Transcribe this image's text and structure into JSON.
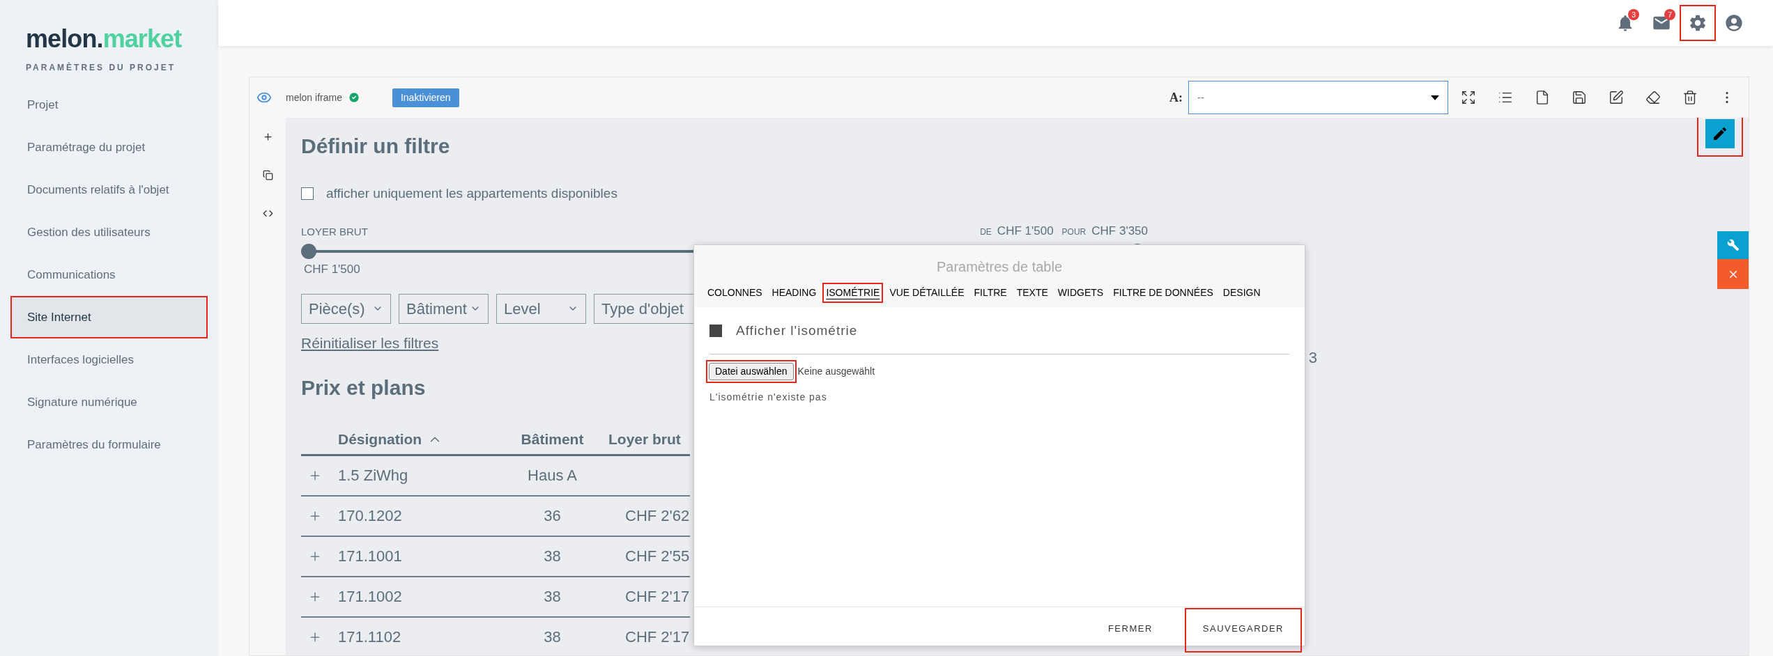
{
  "sidebar": {
    "logo": {
      "primary": "melon.",
      "accent": "market"
    },
    "subtitle": "PARAMÈTRES DU PROJET",
    "items": [
      {
        "label": "Projet",
        "selected": false,
        "highlighted": false
      },
      {
        "label": "Paramétrage du projet",
        "selected": false,
        "highlighted": false
      },
      {
        "label": "Documents relatifs à l'objet",
        "selected": false,
        "highlighted": false
      },
      {
        "label": "Gestion des utilisateurs",
        "selected": false,
        "highlighted": false
      },
      {
        "label": "Communications",
        "selected": false,
        "highlighted": false
      },
      {
        "label": "Site Internet",
        "selected": true,
        "highlighted": true
      },
      {
        "label": "Interfaces logicielles",
        "selected": false,
        "highlighted": false
      },
      {
        "label": "Signature numérique",
        "selected": false,
        "highlighted": false
      },
      {
        "label": "Paramètres du formulaire",
        "selected": false,
        "highlighted": false
      }
    ]
  },
  "topbar": {
    "icons": [
      {
        "kind": "bell",
        "badge": "3",
        "highlighted": false
      },
      {
        "kind": "mail",
        "badge": "7",
        "highlighted": false
      },
      {
        "kind": "gear",
        "highlighted": true
      },
      {
        "kind": "user",
        "highlighted": false
      }
    ]
  },
  "card_toolbar": {
    "name": "melon iframe",
    "verified": true,
    "toggle_button": "Inaktivieren",
    "font_picker": {
      "label": "A:",
      "value": "--"
    },
    "tools": [
      {
        "kind": "expand"
      },
      {
        "kind": "list"
      },
      {
        "kind": "file"
      },
      {
        "kind": "save"
      },
      {
        "kind": "edit"
      },
      {
        "kind": "eraser"
      },
      {
        "kind": "trash"
      },
      {
        "kind": "more"
      }
    ]
  },
  "side_tools": [
    {
      "kind": "add"
    },
    {
      "kind": "copy"
    },
    {
      "kind": "code"
    }
  ],
  "edit_button": {
    "highlighted": true
  },
  "side_tabs": [
    {
      "kind": "wrench"
    },
    {
      "kind": "close"
    }
  ],
  "filter": {
    "title": "Définir un filtre",
    "available_only": {
      "label": "afficher uniquement les appartements disponibles",
      "checked": false
    },
    "rent": {
      "label": "LOYER BRUT",
      "from_word": "DE",
      "from": "CHF 1'500",
      "to_word": "POUR",
      "to": "CHF 3'350",
      "thumbs": [
        {
          "level": 0
        },
        {
          "level": 1
        }
      ],
      "min_label": "CHF 1'500"
    },
    "dropdowns": [
      "Pièce(s)",
      "Bâtiment",
      "Level",
      "Type d'objet"
    ],
    "reset": "Réinitialiser les filtres",
    "count_fragment": "3"
  },
  "table": {
    "title": "Prix et plans",
    "columns": [
      {
        "label": "Désignation",
        "sorted": true
      },
      {
        "label": "Bâtiment",
        "sorted": false
      },
      {
        "label": "Loyer brut",
        "sorted": false
      }
    ],
    "rows": [
      [
        "1.5 ZiWhg",
        "Haus A"
      ],
      [
        "170.1202",
        "36",
        "CHF 2'62"
      ],
      [
        "171.1001",
        "38",
        "CHF 2'55"
      ],
      [
        "171.1002",
        "38",
        "CHF 2'17"
      ],
      [
        "171.1102",
        "38",
        "CHF 2'17"
      ]
    ]
  },
  "dialog": {
    "title": "Paramètres de table",
    "tabs": [
      {
        "label": "COLONNES",
        "selected": false,
        "highlighted": false
      },
      {
        "label": "HEADING",
        "selected": false,
        "highlighted": false
      },
      {
        "label": "ISOMÉTRIE",
        "selected": true,
        "highlighted": true
      },
      {
        "label": "VUE DÉTAILLÉE",
        "selected": false,
        "highlighted": false
      },
      {
        "label": "FILTRE",
        "selected": false,
        "highlighted": false
      },
      {
        "label": "TEXTE",
        "selected": false,
        "highlighted": false
      },
      {
        "label": "WIDGETS",
        "selected": false,
        "highlighted": false
      },
      {
        "label": "FILTRE DE DONNÉES",
        "selected": false,
        "highlighted": false
      },
      {
        "label": "DESIGN",
        "selected": false,
        "highlighted": false
      }
    ],
    "show_isometry": {
      "label": "Afficher l'isométrie",
      "checked": true
    },
    "file": {
      "button": "Datei auswählen",
      "status": "Keine ausgewählt",
      "highlighted": true
    },
    "message": "L'isométrie n'existe pas",
    "buttons": [
      {
        "label": "FERMER",
        "highlighted": false
      },
      {
        "label": "SAUVEGARDER",
        "highlighted": true
      }
    ]
  }
}
